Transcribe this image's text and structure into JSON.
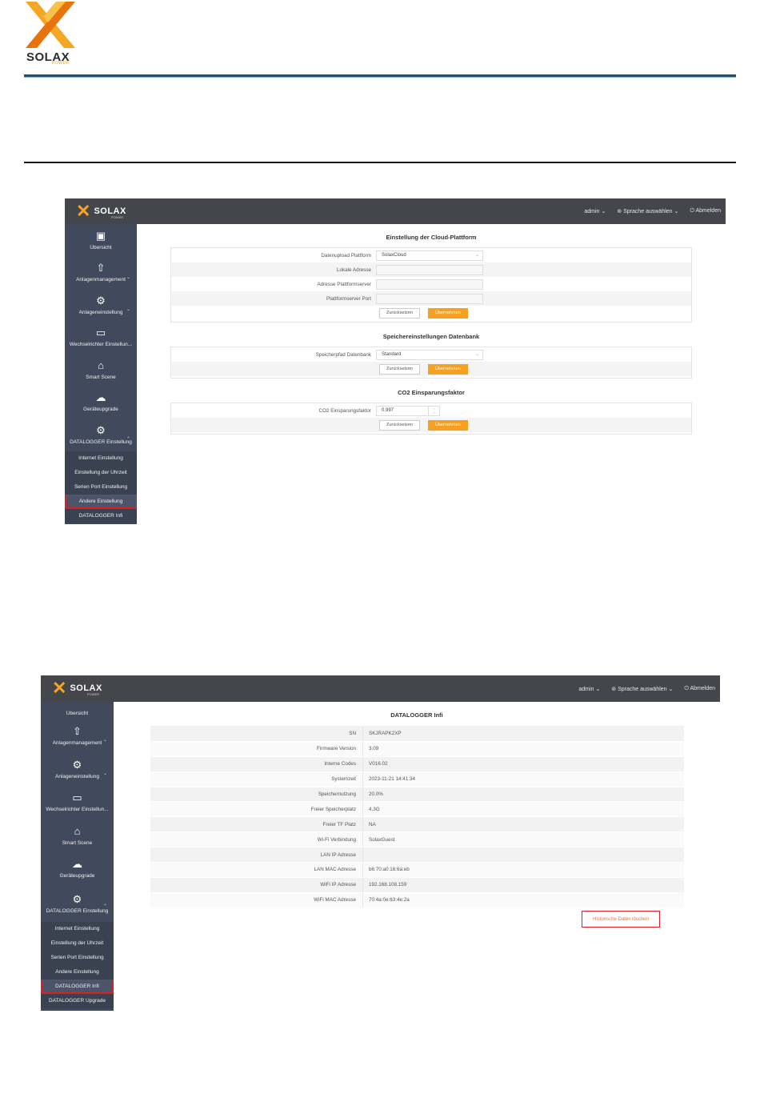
{
  "doc_header": {
    "brand": "SOLAX",
    "brand_sub": "POWER"
  },
  "colors": {
    "accent": "#f5a020",
    "topbar": "#44464b",
    "sidebar": "#414a5c",
    "highlight": "#e02020"
  },
  "screen1": {
    "topbar": {
      "logo": "SOLAX",
      "logo_sub": "POWER",
      "user": "admin ⌄",
      "language": "⊚ Sprache auswählen ⌄",
      "logout": "⏻ Abmelden"
    },
    "nav": [
      {
        "icon": "overview-icon",
        "glyph": "▣",
        "label": "Übersicht"
      },
      {
        "icon": "upload-home-icon",
        "glyph": "⇧",
        "label": "Anlagenmanagement",
        "chevron": "⌄"
      },
      {
        "icon": "gear-monitor-icon",
        "glyph": "⚙",
        "label": "Anlageneinstellung",
        "chevron": "⌄"
      },
      {
        "icon": "inverter-icon",
        "glyph": "▭",
        "label": "Wechselrichter Einstellun..."
      },
      {
        "icon": "smart-home-icon",
        "glyph": "⌂",
        "label": "Smart Scene"
      },
      {
        "icon": "cloud-upload-icon",
        "glyph": "☁",
        "label": "Geräteupgrade"
      },
      {
        "icon": "gear-icon",
        "glyph": "⚙",
        "label": "DATALOGGER Einstellung",
        "chevron": "⌃"
      }
    ],
    "sub_nav": [
      "Internet Einstellung",
      "Einstellung der Uhrzeit",
      "Serien Port Einstellung",
      "Andere Einstellung",
      "DATALOGGER Infi"
    ],
    "cloud": {
      "title": "Einstellung der Cloud-Plattform",
      "rows": [
        {
          "label": "Datenupload Plattform",
          "value": "SolaxCloud",
          "dropdown": "⌄"
        },
        {
          "label": "Lokale Adresse",
          "value": ""
        },
        {
          "label": "Adresse Plattformserver",
          "value": ""
        },
        {
          "label": "Plattformserver Port",
          "value": ""
        }
      ],
      "reset": "Zurücksetzen",
      "save": "Übernehmen"
    },
    "storage": {
      "title": "Speichereinstellungen Datenbank",
      "label": "Speicherpfad Datenbank",
      "value": "Standard",
      "dropdown": "⌄",
      "reset": "Zurücksetzen",
      "save": "Übernehmen"
    },
    "co2": {
      "title": "CO2 Einsparungsfaktor",
      "label": "CO2 Einsparungsfaktor",
      "value": "0.997",
      "spin_up": "˄",
      "spin_down": "˅",
      "reset": "Zurücksetzen",
      "save": "Übernehmen"
    }
  },
  "screen2": {
    "topbar": {
      "logo": "SOLAX",
      "logo_sub": "POWER",
      "user": "admin ⌄",
      "language": "⊚ Sprache auswählen ⌄",
      "logout": "⏻ Abmelden"
    },
    "nav": [
      {
        "icon": "overview-icon",
        "glyph": "",
        "label": "Übersicht"
      },
      {
        "icon": "upload-home-icon",
        "glyph": "⇧",
        "label": "Anlagenmanagement",
        "chevron": "⌄"
      },
      {
        "icon": "gear-monitor-icon",
        "glyph": "⚙",
        "label": "Anlageneinstellung",
        "chevron": "⌄"
      },
      {
        "icon": "inverter-icon",
        "glyph": "▭",
        "label": "Wechselrichter Einstellun..."
      },
      {
        "icon": "smart-home-icon",
        "glyph": "⌂",
        "label": "Smart Scene"
      },
      {
        "icon": "cloud-upload-icon",
        "glyph": "☁",
        "label": "Geräteupgrade"
      },
      {
        "icon": "gear-icon",
        "glyph": "⚙",
        "label": "DATALOGGER Einstellung",
        "chevron": "⌃"
      }
    ],
    "sub_nav": [
      "Internet Einstellung",
      "Einstellung der Uhrzeit",
      "Serien Port Einstellung",
      "Andere Einstellung",
      "DATALOGGER Infi",
      "DATALOGGER Upgrade"
    ],
    "info": {
      "title": "DATALOGGER Infi",
      "rows": [
        {
          "key": "SN",
          "value": "SKJRAPK2XP"
        },
        {
          "key": "Firmware Version",
          "value": "3.09"
        },
        {
          "key": "Interne Codes",
          "value": "V016.02"
        },
        {
          "key": "Systemzeit",
          "value": "2023-11-21 14:41:34"
        },
        {
          "key": "Speichernutzung",
          "value": "20.0%"
        },
        {
          "key": "Freier Speicherplatz",
          "value": "4.3G"
        },
        {
          "key": "Freier TF Platz",
          "value": "NA"
        },
        {
          "key": "Wi-Fi Verbindung",
          "value": "SolaxGuest"
        },
        {
          "key": "LAN IP Adresse",
          "value": ""
        },
        {
          "key": "LAN MAC Adresse",
          "value": "b6:70:a0:16:6a:eb"
        },
        {
          "key": "WiFi IP Adresse",
          "value": "192.168.108.159"
        },
        {
          "key": "WiFi MAC Adresse",
          "value": "70:4a:0e:63:4e:2a"
        }
      ],
      "clear_button": "Historische Daten löschen"
    }
  }
}
